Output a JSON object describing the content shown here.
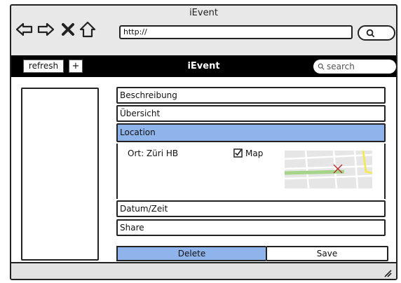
{
  "window": {
    "title": "iEvent",
    "url": "http://"
  },
  "nav_icons": [
    "back-arrow-icon",
    "forward-arrow-icon",
    "close-x-icon",
    "home-icon"
  ],
  "app_bar": {
    "refresh_label": "refresh",
    "add_label": "+",
    "title": "iEvent",
    "search_placeholder": "search"
  },
  "sections": [
    {
      "label": "Beschreibung",
      "selected": false
    },
    {
      "label": "Übersicht",
      "selected": false
    },
    {
      "label": "Location",
      "selected": true
    },
    {
      "label": "Datum/Zeit",
      "selected": false
    },
    {
      "label": "Share",
      "selected": false
    }
  ],
  "location": {
    "ort_label": "Ort: Züri HB",
    "map_label": "Map",
    "map_checked": true
  },
  "actions": {
    "delete_label": "Delete",
    "save_label": "Save"
  },
  "colors": {
    "accent": "#8fb4ec",
    "app_bar": "#000000"
  }
}
